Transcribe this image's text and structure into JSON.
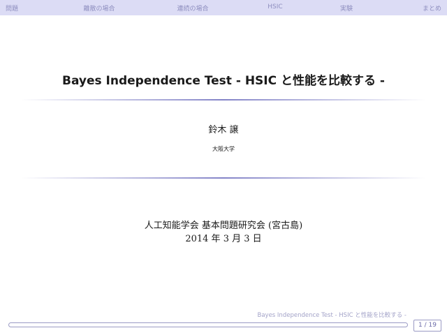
{
  "nav": {
    "items": [
      "問題",
      "離散の場合",
      "連続の場合",
      "HSIC",
      "実験",
      "まとめ"
    ]
  },
  "slide": {
    "title": "Bayes Independence Test - HSIC と性能を比較する -",
    "author": "鈴木 譲",
    "affiliation": "大阪大学",
    "event": "人工知能学会 基本問題研究会 (宮古島)",
    "date": "2014 年 3 月 3 日"
  },
  "footer": {
    "short_title": "Bayes Independence Test - HSIC と性能を比較する -",
    "page": "1 / 19",
    "progress": 0.0526
  },
  "colors": {
    "navbar_bg": "#dcdcf5",
    "nav_text": "#8e8ebf",
    "accent": "#6a6aa8"
  }
}
